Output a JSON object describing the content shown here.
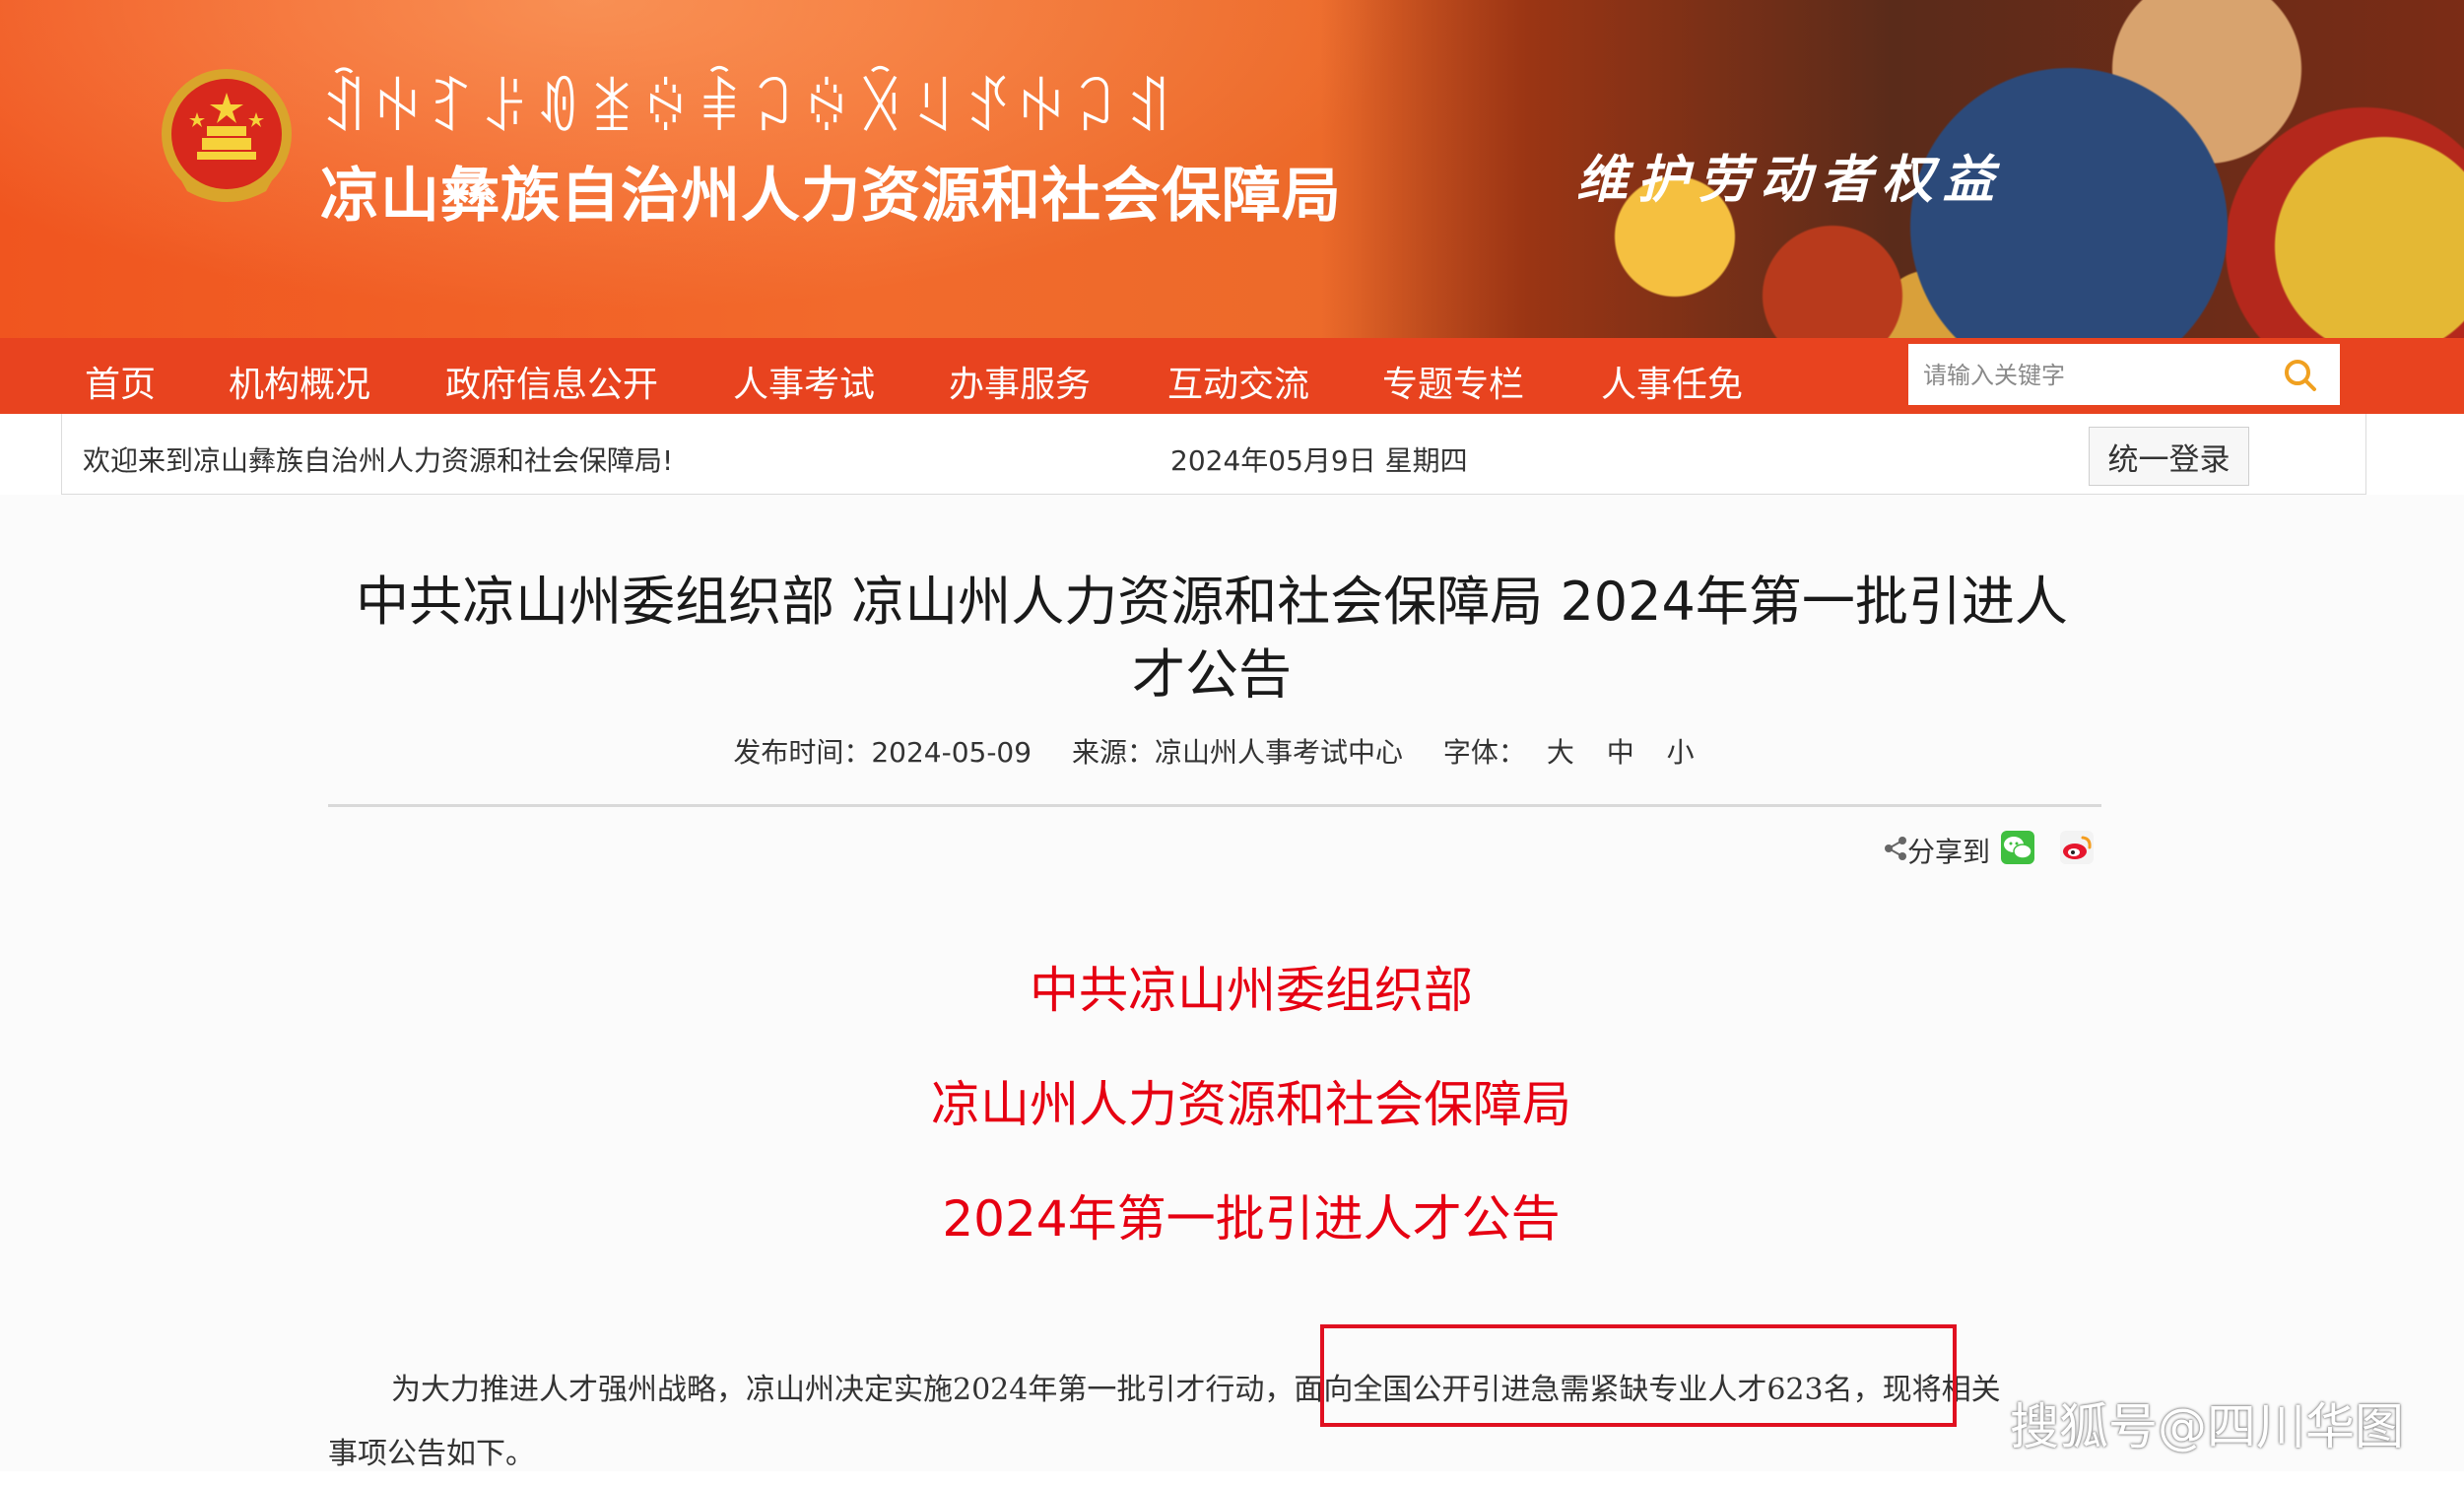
{
  "header": {
    "yi_script": "ꀉꑭꆈꌠꀑꁧꍈꑋꃀꍈꋋꆹꀋꑭꃀꀊ",
    "org_name": "凉山彝族自治州人力资源和社会保障局",
    "slogan": "维护劳动者权益",
    "emblem_icon": "national-emblem-icon"
  },
  "nav": {
    "items": [
      "首页",
      "机构概况",
      "政府信息公开",
      "人事考试",
      "办事服务",
      "互动交流",
      "专题专栏",
      "人事任免"
    ],
    "search_placeholder": "请输入关键字",
    "search_icon": "search-icon"
  },
  "infobar": {
    "welcome": "欢迎来到凉山彝族自治州人力资源和社会保障局!",
    "date": "2024年05月9日 星期四",
    "login": "统一登录"
  },
  "article": {
    "title_line1": "中共凉山州委组织部 凉山州人力资源和社会保障局 2024年第一批引进人",
    "title_line2": "才公告",
    "publish_label": "发布时间：2024-05-09",
    "source_label": "来源：凉山州人事考试中心",
    "font_label": "字体：",
    "font_sizes": [
      "大",
      "中",
      "小"
    ],
    "share_label": "分享到",
    "red_heading": [
      "中共凉山州委组织部",
      "凉山州人力资源和社会保障局",
      "2024年第一批引进人才公告"
    ],
    "para_line1": "为大力推进人才强州战略，凉山州决定实施2024年第一批引才行动，面向全国公开引进急需紧缺专业人才623名，现将相关",
    "para_line2": "事项公告如下。"
  },
  "watermark": "搜狐号@四川华图",
  "colors": {
    "nav_bg": "#e8431f",
    "heading_red": "#e60012",
    "highlight_border": "#e01020"
  }
}
